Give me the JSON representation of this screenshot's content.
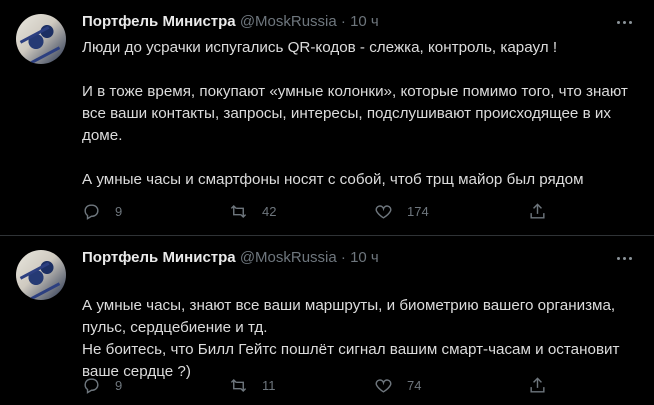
{
  "tweets": [
    {
      "name": "Портфель Министра",
      "handle": "@MoskRussia",
      "sep": "·",
      "time": "10 ч",
      "paragraphs": [
        "Люди до усрачки испугались QR-кодов - слежка, контроль, караул !",
        "И в тоже время, покупают «умные колонки», которые помимо того, что знают все ваши контакты, запросы, интересы, подслушивают происходящее в их доме.",
        "А умные часы и смартфоны носят с собой, чтоб трщ майор был рядом"
      ],
      "stats": {
        "replies": "9",
        "retweets": "42",
        "likes": "174"
      }
    },
    {
      "name": "Портфель Министра",
      "handle": "@MoskRussia",
      "sep": "·",
      "time": "10 ч",
      "text": "А умные часы, знают все ваши маршруты, и биометрию вашего организма, пульс, сердцебиение и тд.\nНе боитесь, что Билл Гейтс пошлёт сигнал вашим смарт-часам и остановит ваше сердце ?)",
      "stats": {
        "replies": "9",
        "retweets": "11",
        "likes": "74"
      }
    }
  ],
  "icons": {
    "more": "more-dots-icon",
    "reply": "reply-icon",
    "retweet": "retweet-icon",
    "like": "heart-icon",
    "share": "share-icon"
  },
  "colors": {
    "background": "#000000",
    "text": "#d9d9d9",
    "muted": "#6e767d",
    "divider": "#2f3336"
  }
}
